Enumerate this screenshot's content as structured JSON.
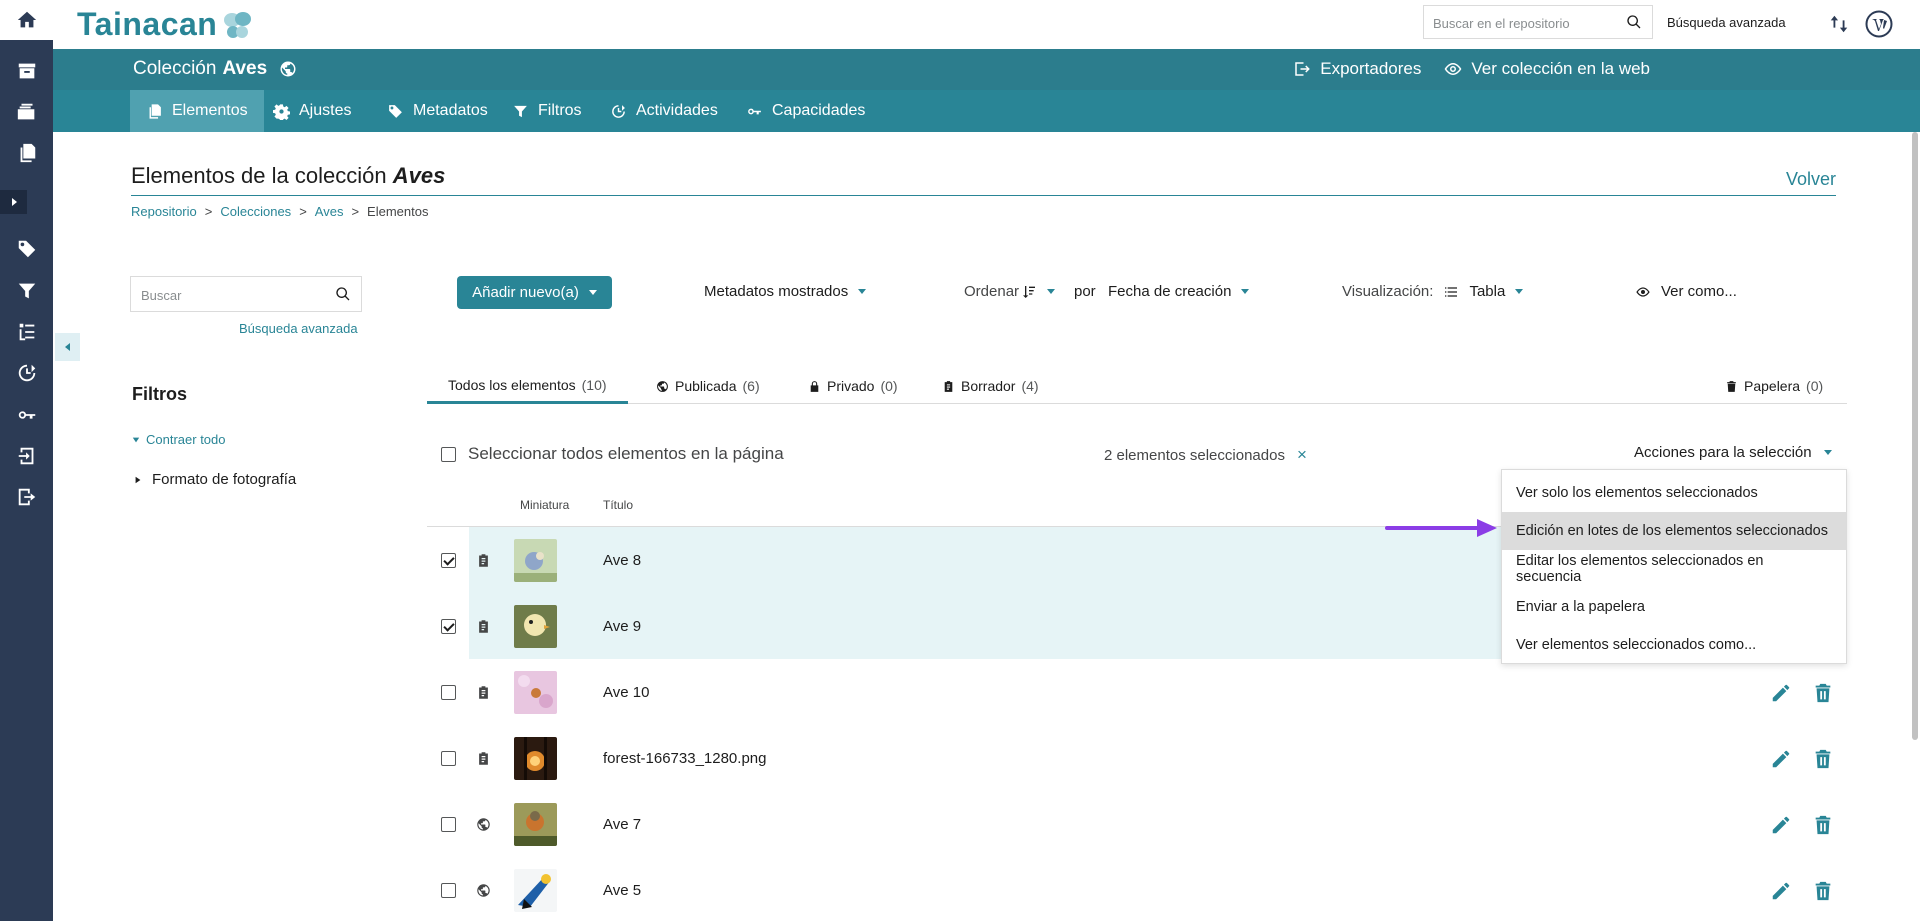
{
  "brand": {
    "logo_text": "Tainacan"
  },
  "topbar": {
    "search_placeholder": "Buscar en el repositorio",
    "advanced_search": "Búsqueda avanzada"
  },
  "collection": {
    "prefix": "Colección",
    "name": "Aves",
    "exporters": "Exportadores",
    "view_web": "Ver colección en la web"
  },
  "subnav": {
    "tabs": [
      {
        "label": "Elementos",
        "icon": "items-icon",
        "active": true
      },
      {
        "label": "Ajustes",
        "icon": "gear-icon"
      },
      {
        "label": "Metadatos",
        "icon": "tags-icon"
      },
      {
        "label": "Filtros",
        "icon": "filter-icon"
      },
      {
        "label": "Actividades",
        "icon": "activities-icon"
      },
      {
        "label": "Capacidades",
        "icon": "key-icon"
      }
    ]
  },
  "page": {
    "title_prefix": "Elementos de la colección",
    "title_collection": "Aves",
    "back": "Volver",
    "breadcrumb": [
      "Repositorio",
      ">",
      "Colecciones",
      ">",
      "Aves",
      ">",
      "Elementos"
    ]
  },
  "left": {
    "search_placeholder": "Buscar",
    "advanced_search": "Búsqueda avanzada",
    "filters_title": "Filtros",
    "collapse_all": "Contraer todo",
    "filter_item": "Formato de fotografía"
  },
  "toolbar": {
    "add_new": "Añadir nuevo(a)",
    "metadata_shown": "Metadatos mostrados",
    "sort_label": "Ordenar",
    "by": "por",
    "sort_field": "Fecha de creación",
    "view_label": "Visualización:",
    "view_mode": "Tabla",
    "view_as": "Ver como..."
  },
  "status_tabs": [
    {
      "label": "Todos los elementos",
      "count": "(10)",
      "active": true
    },
    {
      "label": "Publicada",
      "count": "(6)",
      "icon": "globe-icon"
    },
    {
      "label": "Privado",
      "count": "(0)",
      "icon": "lock-icon"
    },
    {
      "label": "Borrador",
      "count": "(4)",
      "icon": "clipboard-icon"
    },
    {
      "label": "Papelera",
      "count": "(0)",
      "icon": "trash-icon"
    }
  ],
  "selection": {
    "select_all": "Seleccionar todos elementos en la página",
    "selected_count": "2 elementos seleccionados",
    "clear": "×",
    "actions": "Acciones para la selección"
  },
  "table": {
    "headers": {
      "thumbnail": "Miniatura",
      "title": "Título"
    },
    "rows": [
      {
        "title": "Ave 8",
        "checked": true,
        "status_icon": "clipboard-icon"
      },
      {
        "title": "Ave 9",
        "checked": true,
        "status_icon": "clipboard-icon"
      },
      {
        "title": "Ave 10",
        "checked": false,
        "status_icon": "clipboard-icon"
      },
      {
        "title": "forest-166733_1280.png",
        "checked": false,
        "status_icon": "clipboard-icon"
      },
      {
        "title": "Ave 7",
        "checked": false,
        "status_icon": "globe-icon"
      },
      {
        "title": "Ave 5",
        "checked": false,
        "status_icon": "globe-icon"
      }
    ]
  },
  "dropdown": {
    "items": [
      "Ver solo los elementos seleccionados",
      "Edición en lotes de los elementos seleccionados",
      "Editar los elementos seleccionados en secuencia",
      "Enviar a la papelera",
      "Ver elementos seleccionados como..."
    ],
    "highlighted_index": 1
  },
  "colors": {
    "accent": "#298596",
    "header": "#2c7d8d",
    "sidebar": "#2c3b55",
    "pointer_arrow": "#8b3de6"
  }
}
